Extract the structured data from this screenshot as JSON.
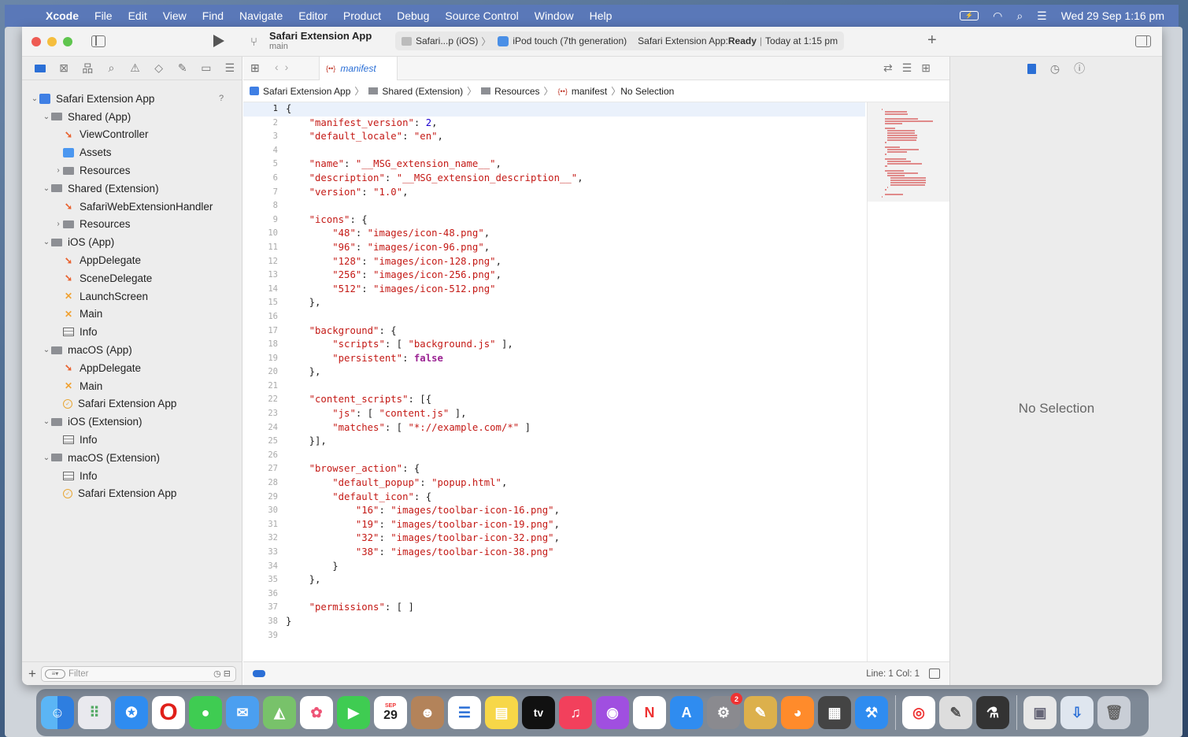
{
  "menubar": {
    "app": "Xcode",
    "items": [
      "File",
      "Edit",
      "View",
      "Find",
      "Navigate",
      "Editor",
      "Product",
      "Debug",
      "Source Control",
      "Window",
      "Help"
    ],
    "clock": "Wed 29 Sep  1:16 pm"
  },
  "toolbar": {
    "project": "Safari Extension App",
    "branch": "main",
    "scheme": "Safari...p (iOS)",
    "device": "iPod touch (7th generation)",
    "status_prefix": "Safari Extension App: ",
    "status_state": "Ready",
    "status_time": "Today at 1:15 pm"
  },
  "navigator": {
    "filter_placeholder": "Filter",
    "items": [
      {
        "label": "Safari Extension App",
        "icon": "app-icon",
        "level": 0,
        "chevron": "down"
      },
      {
        "label": "Shared (App)",
        "icon": "folder-icon",
        "level": 1,
        "chevron": "down"
      },
      {
        "label": "ViewController",
        "icon": "swift-icon",
        "level": 2,
        "chevron": ""
      },
      {
        "label": "Assets",
        "icon": "assets-icon",
        "level": 2,
        "chevron": ""
      },
      {
        "label": "Resources",
        "icon": "folder-icon",
        "level": 2,
        "chevron": "right"
      },
      {
        "label": "Shared (Extension)",
        "icon": "folder-icon",
        "level": 1,
        "chevron": "down"
      },
      {
        "label": "SafariWebExtensionHandler",
        "icon": "swift-icon",
        "level": 2,
        "chevron": ""
      },
      {
        "label": "Resources",
        "icon": "folder-icon",
        "level": 2,
        "chevron": "right"
      },
      {
        "label": "iOS (App)",
        "icon": "folder-icon",
        "level": 1,
        "chevron": "down"
      },
      {
        "label": "AppDelegate",
        "icon": "swift-icon",
        "level": 2,
        "chevron": ""
      },
      {
        "label": "SceneDelegate",
        "icon": "swift-icon",
        "level": 2,
        "chevron": ""
      },
      {
        "label": "LaunchScreen",
        "icon": "storyboard-icon",
        "level": 2,
        "chevron": ""
      },
      {
        "label": "Main",
        "icon": "storyboard-icon",
        "level": 2,
        "chevron": ""
      },
      {
        "label": "Info",
        "icon": "plist-icon",
        "level": 2,
        "chevron": ""
      },
      {
        "label": "macOS (App)",
        "icon": "folder-icon",
        "level": 1,
        "chevron": "down"
      },
      {
        "label": "AppDelegate",
        "icon": "swift-icon",
        "level": 2,
        "chevron": ""
      },
      {
        "label": "Main",
        "icon": "storyboard-icon",
        "level": 2,
        "chevron": ""
      },
      {
        "label": "Safari Extension App",
        "icon": "entitlements-icon",
        "level": 2,
        "chevron": ""
      },
      {
        "label": "iOS (Extension)",
        "icon": "folder-icon",
        "level": 1,
        "chevron": "down"
      },
      {
        "label": "Info",
        "icon": "plist-icon",
        "level": 2,
        "chevron": ""
      },
      {
        "label": "macOS (Extension)",
        "icon": "folder-icon",
        "level": 1,
        "chevron": "down"
      },
      {
        "label": "Info",
        "icon": "plist-icon",
        "level": 2,
        "chevron": ""
      },
      {
        "label": "Safari Extension App",
        "icon": "entitlements-icon",
        "level": 2,
        "chevron": ""
      }
    ]
  },
  "editor": {
    "tab_label": "manifest",
    "json_glyph": "{••}",
    "jumpbar": [
      "Safari Extension App",
      "Shared (Extension)",
      "Resources",
      "manifest",
      "No Selection"
    ],
    "line_col": "Line: 1  Col: 1",
    "lines": [
      "{",
      "    \"manifest_version\": 2,",
      "    \"default_locale\": \"en\",",
      "",
      "    \"name\": \"__MSG_extension_name__\",",
      "    \"description\": \"__MSG_extension_description__\",",
      "    \"version\": \"1.0\",",
      "",
      "    \"icons\": {",
      "        \"48\": \"images/icon-48.png\",",
      "        \"96\": \"images/icon-96.png\",",
      "        \"128\": \"images/icon-128.png\",",
      "        \"256\": \"images/icon-256.png\",",
      "        \"512\": \"images/icon-512.png\"",
      "    },",
      "",
      "    \"background\": {",
      "        \"scripts\": [ \"background.js\" ],",
      "        \"persistent\": false",
      "    },",
      "",
      "    \"content_scripts\": [{",
      "        \"js\": [ \"content.js\" ],",
      "        \"matches\": [ \"*://example.com/*\" ]",
      "    }],",
      "",
      "    \"browser_action\": {",
      "        \"default_popup\": \"popup.html\",",
      "        \"default_icon\": {",
      "            \"16\": \"images/toolbar-icon-16.png\",",
      "            \"19\": \"images/toolbar-icon-19.png\",",
      "            \"32\": \"images/toolbar-icon-32.png\",",
      "            \"38\": \"images/toolbar-icon-38.png\"",
      "        }",
      "    },",
      "",
      "    \"permissions\": [ ]",
      "}",
      ""
    ]
  },
  "inspector": {
    "empty_label": "No Selection"
  },
  "dock": {
    "calendar_month": "SEP",
    "calendar_day": "29",
    "tv_label": "tv",
    "settings_badge": "2",
    "apps": [
      "Finder",
      "Launchpad",
      "Safari",
      "Opera",
      "Messages",
      "Mail",
      "Maps",
      "Photos",
      "FaceTime",
      "Calendar",
      "Contacts",
      "Reminders",
      "Notes",
      "TV",
      "Music",
      "Podcasts",
      "News",
      "App Store",
      "System Preferences",
      "Utilities",
      "Firefox",
      "Calculator",
      "Xcode",
      "Chrome",
      "Script Editor",
      "Instruments",
      "Preview",
      "Downloads",
      "Trash"
    ]
  },
  "colors": {
    "accent": "#2b6fd6",
    "string": "#c41a16",
    "number": "#1c00cf",
    "keyword": "#9b2393",
    "menubar": "#5a78b8"
  }
}
